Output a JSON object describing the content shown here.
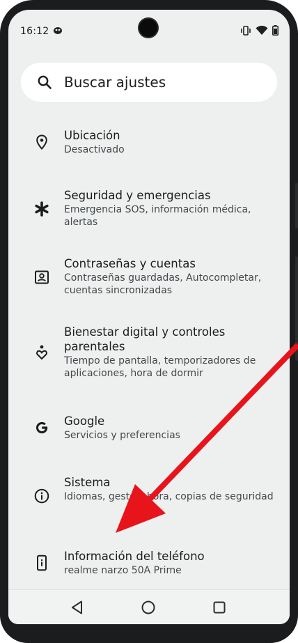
{
  "status_bar": {
    "time": "16:12",
    "left_icon": "notification-bubble-icon",
    "right_icons": [
      "vibrate-icon",
      "wifi-icon",
      "battery-icon"
    ]
  },
  "search": {
    "placeholder": "Buscar ajustes",
    "icon": "search-icon"
  },
  "settings": {
    "items": [
      {
        "title": "Ubicación",
        "subtitle": "Desactivado",
        "icon": "location-pin-icon"
      },
      {
        "title": "Seguridad y emergencias",
        "subtitle": "Emergencia SOS, información médica, alertas",
        "icon": "asterisk-icon"
      },
      {
        "title": "Contraseñas y cuentas",
        "subtitle": "Contraseñas guardadas, Autocompletar, cuentas sincronizadas",
        "icon": "account-box-icon"
      },
      {
        "title": "Bienestar digital y controles parentales",
        "subtitle": "Tiempo de pantalla, temporizadores de aplicaciones, hora de dormir",
        "icon": "wellbeing-heart-icon"
      },
      {
        "title": "Google",
        "subtitle": "Servicios y preferencias",
        "icon": "google-g-icon"
      },
      {
        "title": "Sistema",
        "subtitle": "Idiomas, gestos, hora, copias de seguridad",
        "icon": "info-circle-icon"
      },
      {
        "title": "Información del teléfono",
        "subtitle": "realme narzo 50A Prime",
        "icon": "phone-info-icon"
      }
    ]
  },
  "nav_bar": {
    "buttons": [
      "back-icon",
      "home-icon",
      "recents-icon"
    ]
  },
  "annotation": {
    "arrow_color": "#e8141c"
  },
  "colors": {
    "screen_bg": "#eef0f0",
    "bezel": "#1b1c1e",
    "text_primary": "#1b1c1d",
    "text_secondary": "#44484b"
  }
}
